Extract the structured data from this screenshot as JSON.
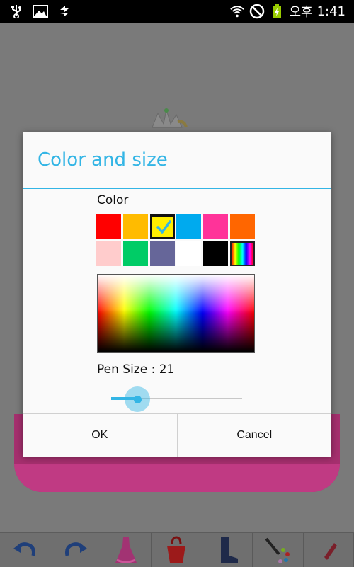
{
  "status_bar": {
    "ampm": "오후",
    "time": "1:41",
    "icons": [
      "usb-icon",
      "image-icon",
      "sync-icon",
      "wifi-icon",
      "no-signal-icon",
      "battery-charging-icon"
    ]
  },
  "dialog": {
    "title": "Color and size",
    "color_label": "Color",
    "swatches": [
      {
        "name": "red",
        "color": "#ff0000"
      },
      {
        "name": "amber",
        "color": "#ffbb00"
      },
      {
        "name": "yellow",
        "color": "#ffee00",
        "selected": true
      },
      {
        "name": "sky-blue",
        "color": "#00aaee"
      },
      {
        "name": "pink",
        "color": "#ff3399"
      },
      {
        "name": "orange",
        "color": "#ff6600"
      },
      {
        "name": "light-pink",
        "color": "#ffcccc"
      },
      {
        "name": "green",
        "color": "#00cc66"
      },
      {
        "name": "slate-blue",
        "color": "#666699"
      },
      {
        "name": "white",
        "color": "#ffffff"
      },
      {
        "name": "black",
        "color": "#000000"
      },
      {
        "name": "rainbow",
        "color": "rainbow"
      }
    ],
    "pen_size_label": "Pen Size : 21",
    "pen_size_value": 21,
    "pen_size_fraction": 0.21,
    "ok_label": "OK",
    "cancel_label": "Cancel"
  },
  "accent_color": "#33b5e5",
  "toolbar": {
    "tools": [
      "undo-icon",
      "redo-icon",
      "dress-icon",
      "bag-icon",
      "boots-icon",
      "palette-pen-icon",
      "eraser-icon"
    ]
  }
}
